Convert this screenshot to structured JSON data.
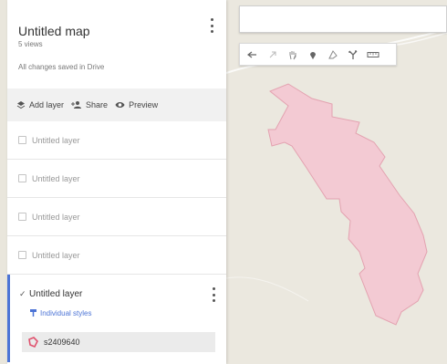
{
  "map": {
    "title": "Untitled map",
    "views": "5 views",
    "save_status": "All changes saved in Drive",
    "menu_icon": "more-vert-icon"
  },
  "actions": [
    {
      "label": "Add layer",
      "icon": "add-layer-icon"
    },
    {
      "label": "Share",
      "icon": "add-person-icon"
    },
    {
      "label": "Preview",
      "icon": "eye-icon"
    }
  ],
  "layers": [
    {
      "label": "Untitled layer",
      "checked": false
    },
    {
      "label": "Untitled layer",
      "checked": false
    },
    {
      "label": "Untitled layer",
      "checked": false
    },
    {
      "label": "Untitled layer",
      "checked": false
    }
  ],
  "active_layer": {
    "label": "Untitled layer",
    "checked": true,
    "styles_label": "Individual styles",
    "feature_label": "s2409640"
  },
  "toolbar": {
    "tools": [
      "undo-icon",
      "redo-icon",
      "hand-icon",
      "marker-icon",
      "draw-line-icon",
      "route-icon",
      "ruler-icon"
    ]
  },
  "colors": {
    "accent": "#4c74d6",
    "polygon_fill": "#f3cad3",
    "polygon_stroke": "#e3a2b0",
    "feature_icon": "#e0536f"
  }
}
